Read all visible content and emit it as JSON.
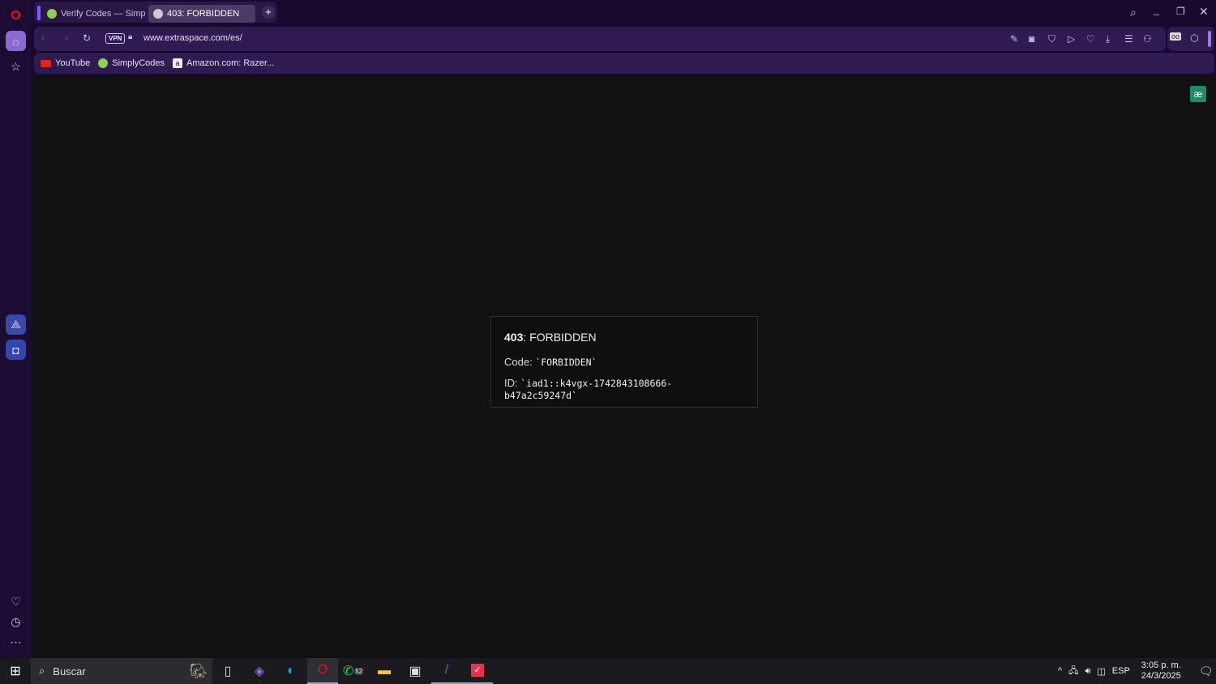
{
  "tabs": [
    {
      "label": "Verify Codes — SimplyCodes",
      "active": false
    },
    {
      "label": "403: FORBIDDEN",
      "active": true
    }
  ],
  "address": {
    "vpn": "VPN",
    "url": "www.extraspace.com/es/"
  },
  "bookmarks": [
    {
      "label": "YouTube"
    },
    {
      "label": "SimplyCodes"
    },
    {
      "label": "Amazon.com: Razer..."
    }
  ],
  "error": {
    "status": "403",
    "status_text": ": FORBIDDEN",
    "code_label": "Code: ",
    "code_value": "`FORBIDDEN`",
    "id_label": "ID: ",
    "id_value": "`iad1::k4vgx-1742843108666-b47a2c59247d`"
  },
  "taskbar": {
    "search_placeholder": "Buscar",
    "whatsapp_badge": "52",
    "lang": "ESP",
    "time": "3:05 p. m.",
    "date": "24/3/2025"
  },
  "colors": {
    "accent": "#7b5cff",
    "opera_red": "#e0141e"
  }
}
